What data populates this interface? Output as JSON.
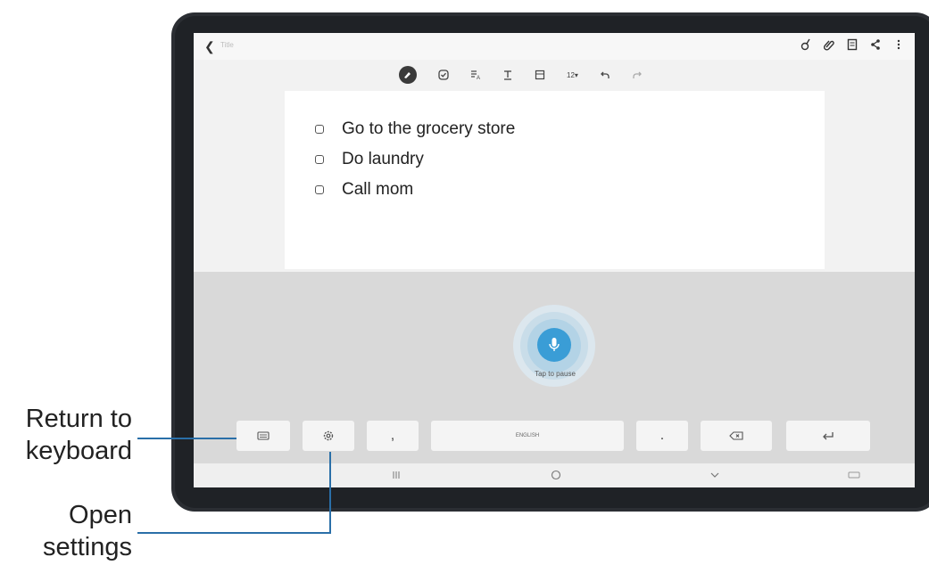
{
  "note": {
    "title_placeholder": "Title",
    "items": [
      {
        "text": "Go to the grocery store"
      },
      {
        "text": "Do laundry"
      },
      {
        "text": "Call mom"
      }
    ]
  },
  "toolbar": {
    "font_size": "12▾"
  },
  "voice": {
    "status": "Tap to pause"
  },
  "keyboard": {
    "comma": ",",
    "space_label": "ENGLISH",
    "period": "."
  },
  "callouts": {
    "return_line1": "Return to",
    "return_line2": "keyboard",
    "settings_line1": "Open",
    "settings_line2": "settings"
  },
  "colors": {
    "accent": "#3a9dd6",
    "callout_line": "#2a6fa8"
  },
  "icons": [
    "back-arrow-icon",
    "pen-icon",
    "attach-icon",
    "page-icon",
    "share-icon",
    "more-icon",
    "handwriting-icon",
    "checkbox-icon",
    "text-style-icon",
    "text-format-icon",
    "layout-icon",
    "undo-icon",
    "redo-icon",
    "microphone-icon",
    "keyboard-icon",
    "gear-icon",
    "backspace-icon",
    "enter-icon"
  ]
}
